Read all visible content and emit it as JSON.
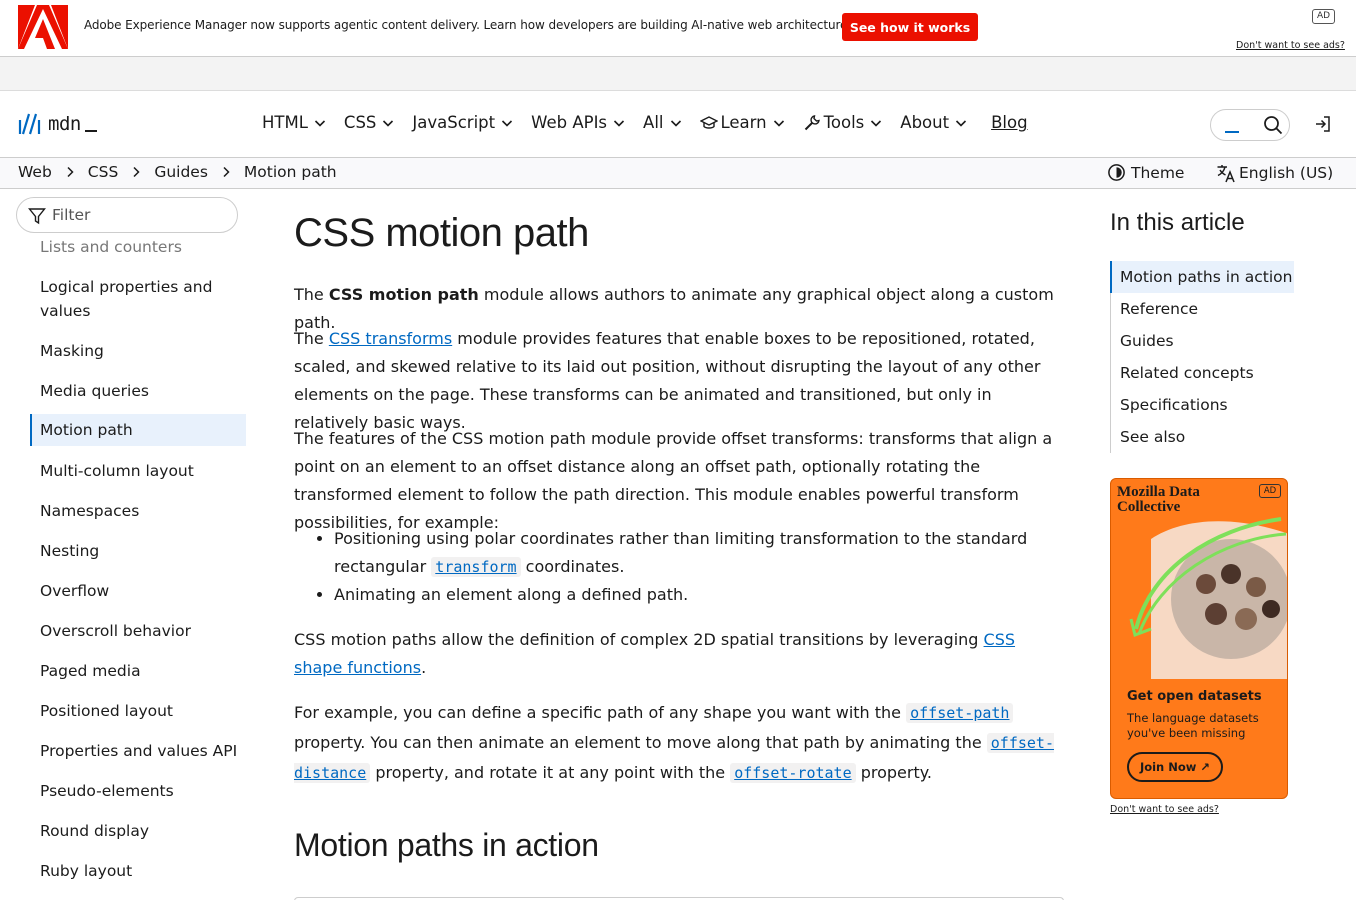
{
  "ad_banner": {
    "message": "Adobe Experience Manager now supports agentic content delivery. Learn how developers are building AI-native web architecture.",
    "cta_label": "See how it works",
    "ad_tag": "AD",
    "no_ads_link": "Don't want to see ads?",
    "brand_color": "#eb1000"
  },
  "nav": {
    "brand": "mdn",
    "items": [
      {
        "label": "HTML",
        "icon": "chevron-down-icon"
      },
      {
        "label": "CSS",
        "icon": "chevron-down-icon"
      },
      {
        "label": "JavaScript",
        "icon": "chevron-down-icon"
      },
      {
        "label": "Web APIs",
        "icon": "chevron-down-icon"
      },
      {
        "label": "All",
        "icon": "chevron-down-icon"
      },
      {
        "label": "Learn",
        "icon": "graduation-cap-icon"
      },
      {
        "label": "Tools",
        "icon": "wrench-icon"
      },
      {
        "label": "About",
        "icon": "chevron-down-icon"
      }
    ],
    "blog_label": "Blog"
  },
  "breadcrumb": {
    "items": [
      "Web",
      "CSS",
      "Guides",
      "Motion path"
    ],
    "theme_label": "Theme",
    "language_label": "English (US)"
  },
  "sidebar": {
    "filter_placeholder": "Filter",
    "items": [
      {
        "label": "Lists and counters"
      },
      {
        "label": "Logical properties and values"
      },
      {
        "label": "Masking"
      },
      {
        "label": "Media queries"
      },
      {
        "label": "Motion path",
        "active": true
      },
      {
        "label": "Multi-column layout"
      },
      {
        "label": "Namespaces"
      },
      {
        "label": "Nesting"
      },
      {
        "label": "Overflow"
      },
      {
        "label": "Overscroll behavior"
      },
      {
        "label": "Paged media"
      },
      {
        "label": "Positioned layout"
      },
      {
        "label": "Properties and values API"
      },
      {
        "label": "Pseudo-elements"
      },
      {
        "label": "Round display"
      },
      {
        "label": "Ruby layout"
      }
    ]
  },
  "article": {
    "title": "CSS motion path",
    "p1": {
      "before": "The ",
      "strong": "CSS motion path",
      "after": " module allows authors to animate any graphical object along a custom path."
    },
    "p2": {
      "before": "The ",
      "link": "CSS transforms",
      "after": " module provides features that enable boxes to be repositioned, rotated, scaled, and skewed relative to its laid out position, without disrupting the layout of any other elements on the page. These transforms can be animated and transitioned, but only in relatively basic ways."
    },
    "p3": "The features of the CSS motion path module provide offset transforms: transforms that align a point on an element to an offset distance along an offset path, optionally rotating the transformed element to follow the path direction. This module enables powerful transform possibilities, for example:",
    "li1": {
      "before": "Positioning using polar coordinates rather than limiting transformation to the standard rectangular ",
      "code": "transform",
      "after": " coordinates."
    },
    "li2": "Animating an element along a defined path.",
    "p4": {
      "before": "CSS motion paths allow the definition of complex 2D spatial transitions by leveraging ",
      "link": "CSS shape functions",
      "after": "."
    },
    "p5": {
      "t1": "For example, you can define a specific path of any shape you want with the ",
      "c1": "offset-path",
      "t2": " property. You can then animate an element to move along that path by animating the ",
      "c2": "offset-distance",
      "t3": " property, and rotate it at any point with the ",
      "c3": "offset-rotate",
      "t4": " property."
    },
    "h2": "Motion paths in action"
  },
  "toc": {
    "title": "In this article",
    "items": [
      {
        "label": "Motion paths in action",
        "current": true
      },
      {
        "label": "Reference"
      },
      {
        "label": "Guides"
      },
      {
        "label": "Related concepts"
      },
      {
        "label": "Specifications"
      },
      {
        "label": "See also"
      }
    ]
  },
  "side_ad": {
    "brand": "Mozilla Data Collective",
    "ad_tag": "AD",
    "headline": "Get open datasets",
    "subtext": "The language datasets you've been missing",
    "cta_label": "Join Now",
    "no_ads_link": "Don't want to see ads?",
    "bg_color": "#ff7a1a"
  },
  "colors": {
    "link": "#0069c2",
    "active_bg": "#e8f1fc"
  }
}
